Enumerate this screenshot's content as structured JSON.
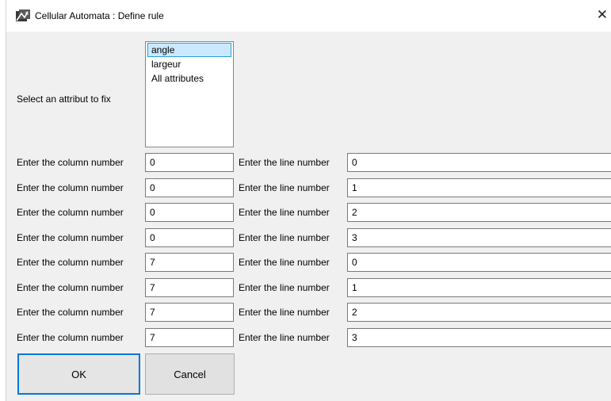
{
  "window": {
    "title": "Cellular Automata : Define rule",
    "close_glyph": "✕",
    "icon": "app-icon"
  },
  "attribute_selector": {
    "label": "Select an attribut to fix",
    "items": [
      "angle",
      "largeur",
      "All attributes"
    ],
    "selected_index": 0
  },
  "rows": [
    {
      "column_label": "Enter the column number",
      "column_value": "0",
      "line_label": "Enter the line number",
      "line_value": "0"
    },
    {
      "column_label": "Enter the column number",
      "column_value": "0",
      "line_label": "Enter the line number",
      "line_value": "1"
    },
    {
      "column_label": "Enter the column number",
      "column_value": "0",
      "line_label": "Enter the line number",
      "line_value": "2"
    },
    {
      "column_label": "Enter the column number",
      "column_value": "0",
      "line_label": "Enter the line number",
      "line_value": "3"
    },
    {
      "column_label": "Enter the column number",
      "column_value": "7",
      "line_label": "Enter the line number",
      "line_value": "0"
    },
    {
      "column_label": "Enter the column number",
      "column_value": "7",
      "line_label": "Enter the line number",
      "line_value": "1"
    },
    {
      "column_label": "Enter the column number",
      "column_value": "7",
      "line_label": "Enter the line number",
      "line_value": "2"
    },
    {
      "column_label": "Enter the column number",
      "column_value": "7",
      "line_label": "Enter the line number",
      "line_value": "3"
    }
  ],
  "buttons": {
    "ok_label": "OK",
    "cancel_label": "Cancel"
  }
}
